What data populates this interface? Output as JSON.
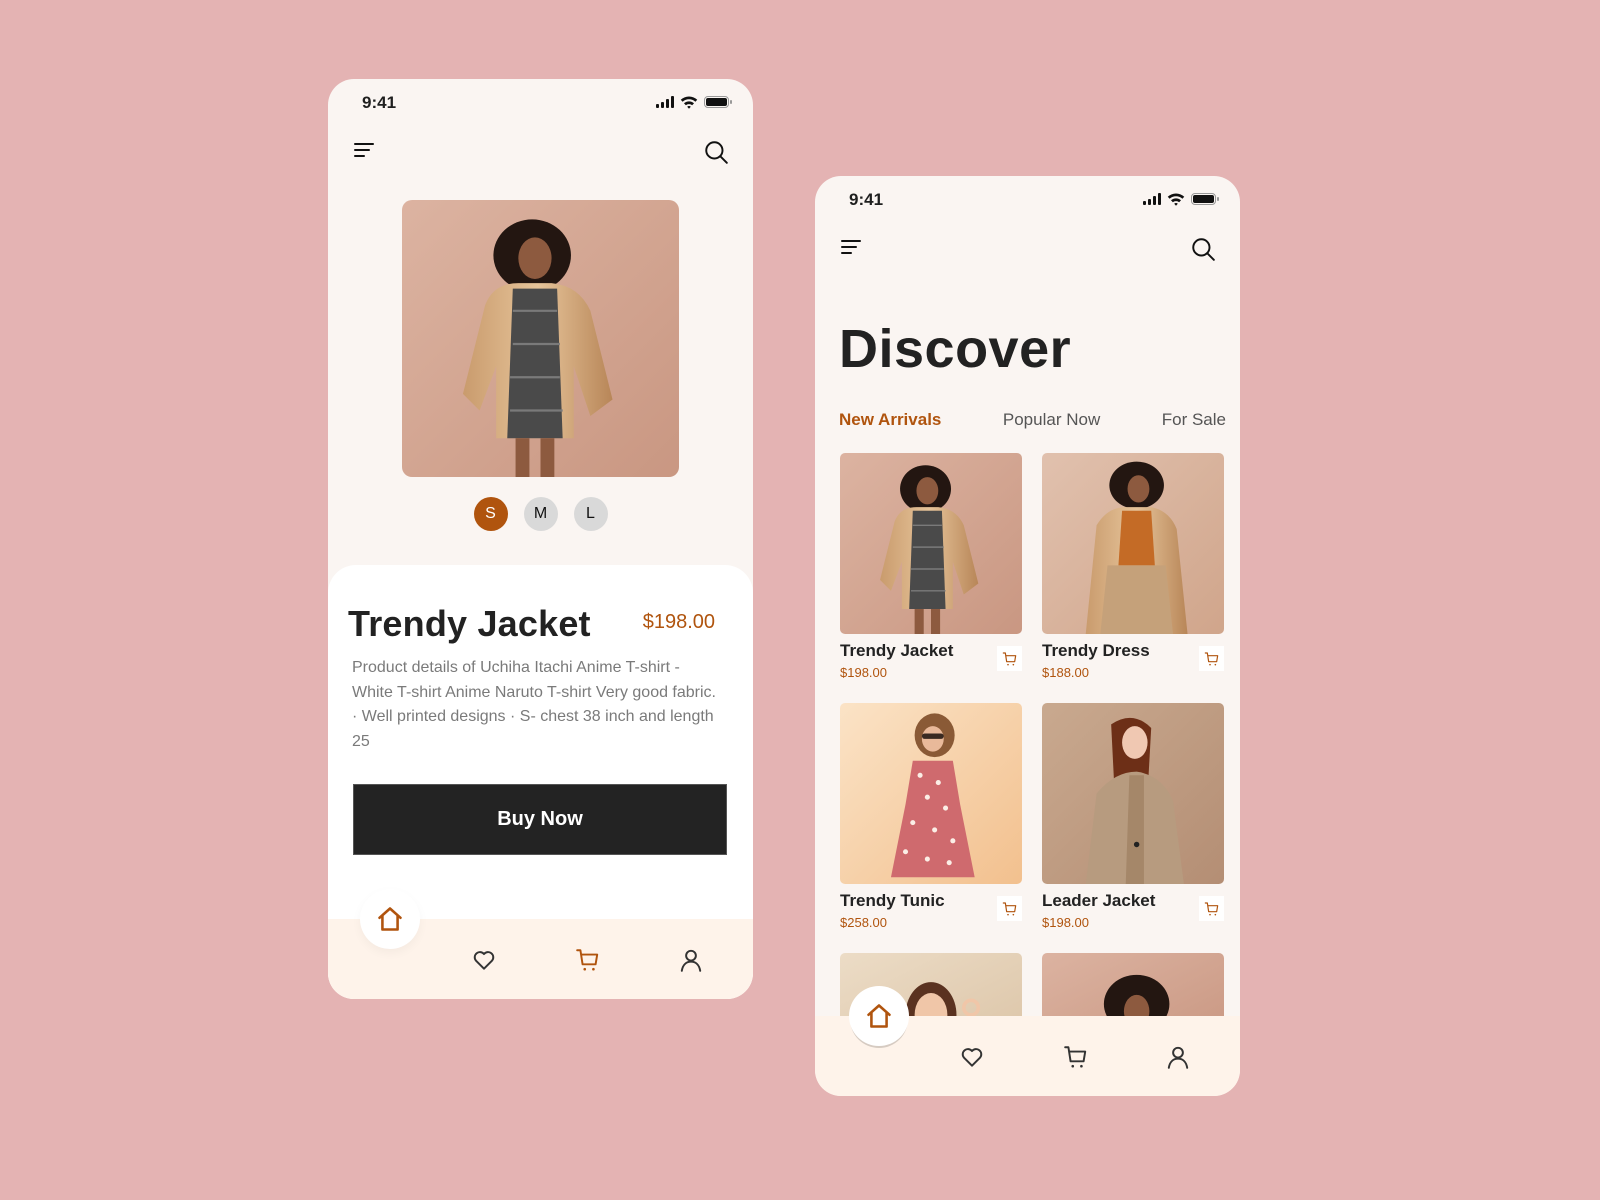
{
  "colors": {
    "accent": "#b0540e",
    "dark": "#232323",
    "background": "#e4b3b3",
    "screen": "#faf5f2",
    "tabbar": "#fef3ea"
  },
  "product_screen": {
    "status_time": "9:41",
    "menu_icon": "menu-icon",
    "search_icon": "search-icon",
    "sizes": [
      {
        "label": "S",
        "selected": true
      },
      {
        "label": "M",
        "selected": false
      },
      {
        "label": "L",
        "selected": false
      }
    ],
    "product": {
      "title": "Trendy Jacket",
      "price": "$198.00",
      "description": "Product details of Uchiha Itachi Anime T-shirt - White T-shirt Anime Naruto T-shirt Very good fabric. · Well printed designs · S- chest 38 inch and length 25"
    },
    "buy_button": "Buy Now",
    "tabbar": [
      {
        "icon": "home-icon",
        "active": true
      },
      {
        "icon": "heart-icon",
        "active": false
      },
      {
        "icon": "cart-icon",
        "active": true
      },
      {
        "icon": "user-icon",
        "active": false
      }
    ]
  },
  "discover_screen": {
    "status_time": "9:41",
    "title": "Discover",
    "filters": [
      {
        "label": "New Arrivals",
        "active": true
      },
      {
        "label": "Popular Now",
        "active": false
      },
      {
        "label": "For Sale",
        "active": false
      }
    ],
    "products": [
      {
        "name": "Trendy Jacket",
        "price": "$198.00"
      },
      {
        "name": "Trendy Dress",
        "price": "$188.00"
      },
      {
        "name": "Trendy Tunic",
        "price": "$258.00"
      },
      {
        "name": "Leader Jacket",
        "price": "$198.00"
      }
    ],
    "tabbar": [
      {
        "icon": "home-icon",
        "active": true
      },
      {
        "icon": "heart-icon",
        "active": false
      },
      {
        "icon": "cart-icon",
        "active": false
      },
      {
        "icon": "user-icon",
        "active": false
      }
    ]
  }
}
